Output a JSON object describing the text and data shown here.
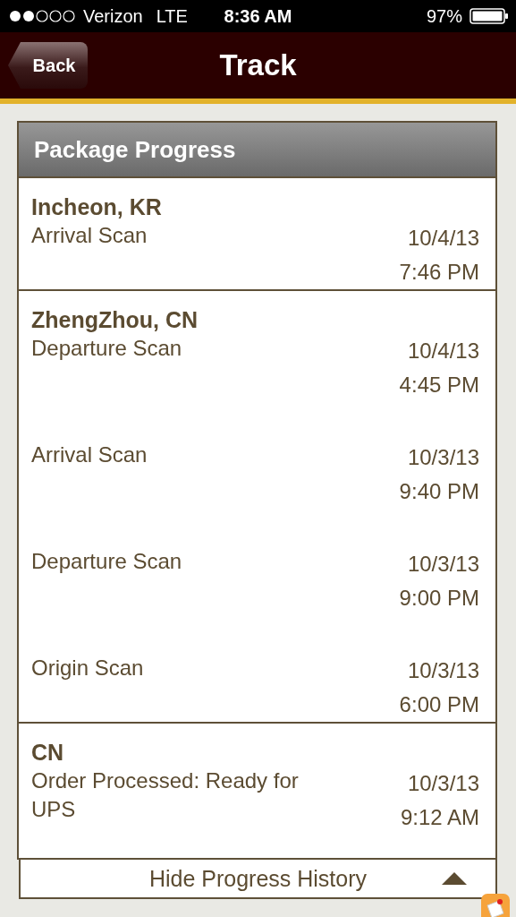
{
  "status_bar": {
    "carrier": "Verizon",
    "network": "LTE",
    "time": "8:36 AM",
    "battery": "97%"
  },
  "nav_bar": {
    "back": "Back",
    "title": "Track"
  },
  "progress": {
    "title": "Package Progress",
    "groups": [
      {
        "location": "Incheon, KR",
        "events": [
          {
            "description": "Arrival Scan",
            "date": "10/4/13",
            "time": "7:46 PM"
          }
        ]
      },
      {
        "location": "ZhengZhou, CN",
        "events": [
          {
            "description": "Departure Scan",
            "date": "10/4/13",
            "time": "4:45 PM"
          },
          {
            "description": "Arrival Scan",
            "date": "10/3/13",
            "time": "9:40 PM"
          },
          {
            "description": "Departure Scan",
            "date": "10/3/13",
            "time": "9:00 PM"
          },
          {
            "description": "Origin Scan",
            "date": "10/3/13",
            "time": "6:00 PM"
          }
        ]
      },
      {
        "location": "CN",
        "events": [
          {
            "description": "Order Processed: Ready for UPS",
            "date": "10/3/13",
            "time": "9:12 AM"
          }
        ]
      }
    ],
    "toggle": {
      "label": "Hide Progress History",
      "expanded": true
    }
  }
}
